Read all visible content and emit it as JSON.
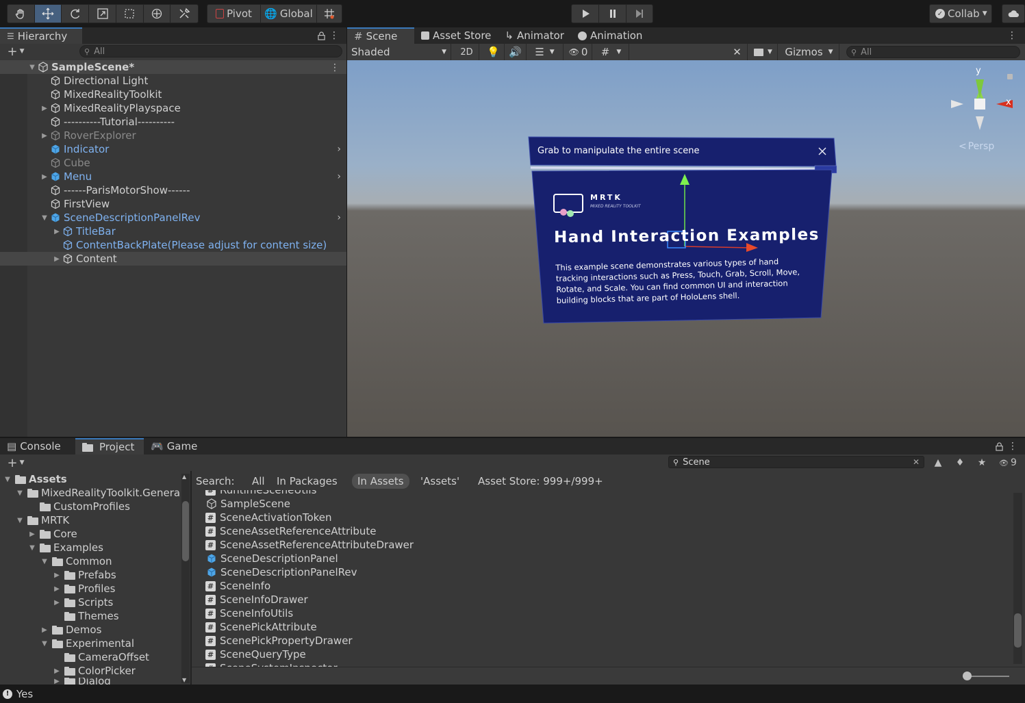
{
  "toolbar": {
    "pivot_label": "Pivot",
    "global_label": "Global",
    "collab_label": "Collab"
  },
  "hierarchy": {
    "tab_label": "Hierarchy",
    "search_placeholder": "All",
    "scene_name": "SampleScene*",
    "items": [
      {
        "label": "Directional Light"
      },
      {
        "label": "MixedRealityToolkit"
      },
      {
        "label": "MixedRealityPlayspace"
      },
      {
        "label": "----------Tutorial----------"
      },
      {
        "label": "RoverExplorer"
      },
      {
        "label": "Indicator"
      },
      {
        "label": "Cube"
      },
      {
        "label": "Menu"
      },
      {
        "label": "------ParisMotorShow------"
      },
      {
        "label": "FirstView"
      },
      {
        "label": "SceneDescriptionPanelRev"
      },
      {
        "label": "TitleBar"
      },
      {
        "label": "ContentBackPlate(Please adjust for content size)"
      },
      {
        "label": "Content"
      }
    ]
  },
  "scene": {
    "tabs": [
      "Scene",
      "Asset Store",
      "Animator",
      "Animation"
    ],
    "shading_mode": "Shaded",
    "mode_2d": "2D",
    "hidden_count": "0",
    "gizmos_label": "Gizmos",
    "search_placeholder": "All",
    "gizmo_y": "y",
    "gizmo_x": "x",
    "persp_label": "Persp",
    "panel_title": "Grab to manipulate the entire scene",
    "logo_text": "MRTK",
    "logo_sub": "MIXED REALITY TOOLKIT",
    "headline": "Hand Interaction Examples",
    "body": "This example scene demonstrates various types of hand tracking interactions such as Press, Touch, Grab, Scroll, Move, Rotate, and Scale. You can find common UI and interaction building blocks that are part of HoloLens shell."
  },
  "bottom": {
    "tabs": [
      "Console",
      "Project",
      "Game"
    ],
    "search_value": "Scene",
    "hidden_badge": "9",
    "search_label": "Search:",
    "filters": [
      "All",
      "In Packages",
      "In Assets",
      "'Assets'",
      "Asset Store: 999+/999+"
    ],
    "tree": [
      {
        "label": "Assets"
      },
      {
        "label": "MixedRealityToolkit.Genera"
      },
      {
        "label": "CustomProfiles"
      },
      {
        "label": "MRTK"
      },
      {
        "label": "Core"
      },
      {
        "label": "Examples"
      },
      {
        "label": "Common"
      },
      {
        "label": "Prefabs"
      },
      {
        "label": "Profiles"
      },
      {
        "label": "Scripts"
      },
      {
        "label": "Themes"
      },
      {
        "label": "Demos"
      },
      {
        "label": "Experimental"
      },
      {
        "label": "CameraOffset"
      },
      {
        "label": "ColorPicker"
      },
      {
        "label": "Dialog"
      }
    ],
    "results": [
      {
        "label": "RuntimeSceneUtils"
      },
      {
        "label": "SampleScene"
      },
      {
        "label": "SceneActivationToken"
      },
      {
        "label": "SceneAssetReferenceAttribute"
      },
      {
        "label": "SceneAssetReferenceAttributeDrawer"
      },
      {
        "label": "SceneDescriptionPanel"
      },
      {
        "label": "SceneDescriptionPanelRev"
      },
      {
        "label": "SceneInfo"
      },
      {
        "label": "SceneInfoDrawer"
      },
      {
        "label": "SceneInfoUtils"
      },
      {
        "label": "ScenePickAttribute"
      },
      {
        "label": "ScenePickPropertyDrawer"
      },
      {
        "label": "SceneQueryType"
      },
      {
        "label": "SceneSystemInspector"
      }
    ]
  },
  "status": {
    "text": "Yes"
  }
}
